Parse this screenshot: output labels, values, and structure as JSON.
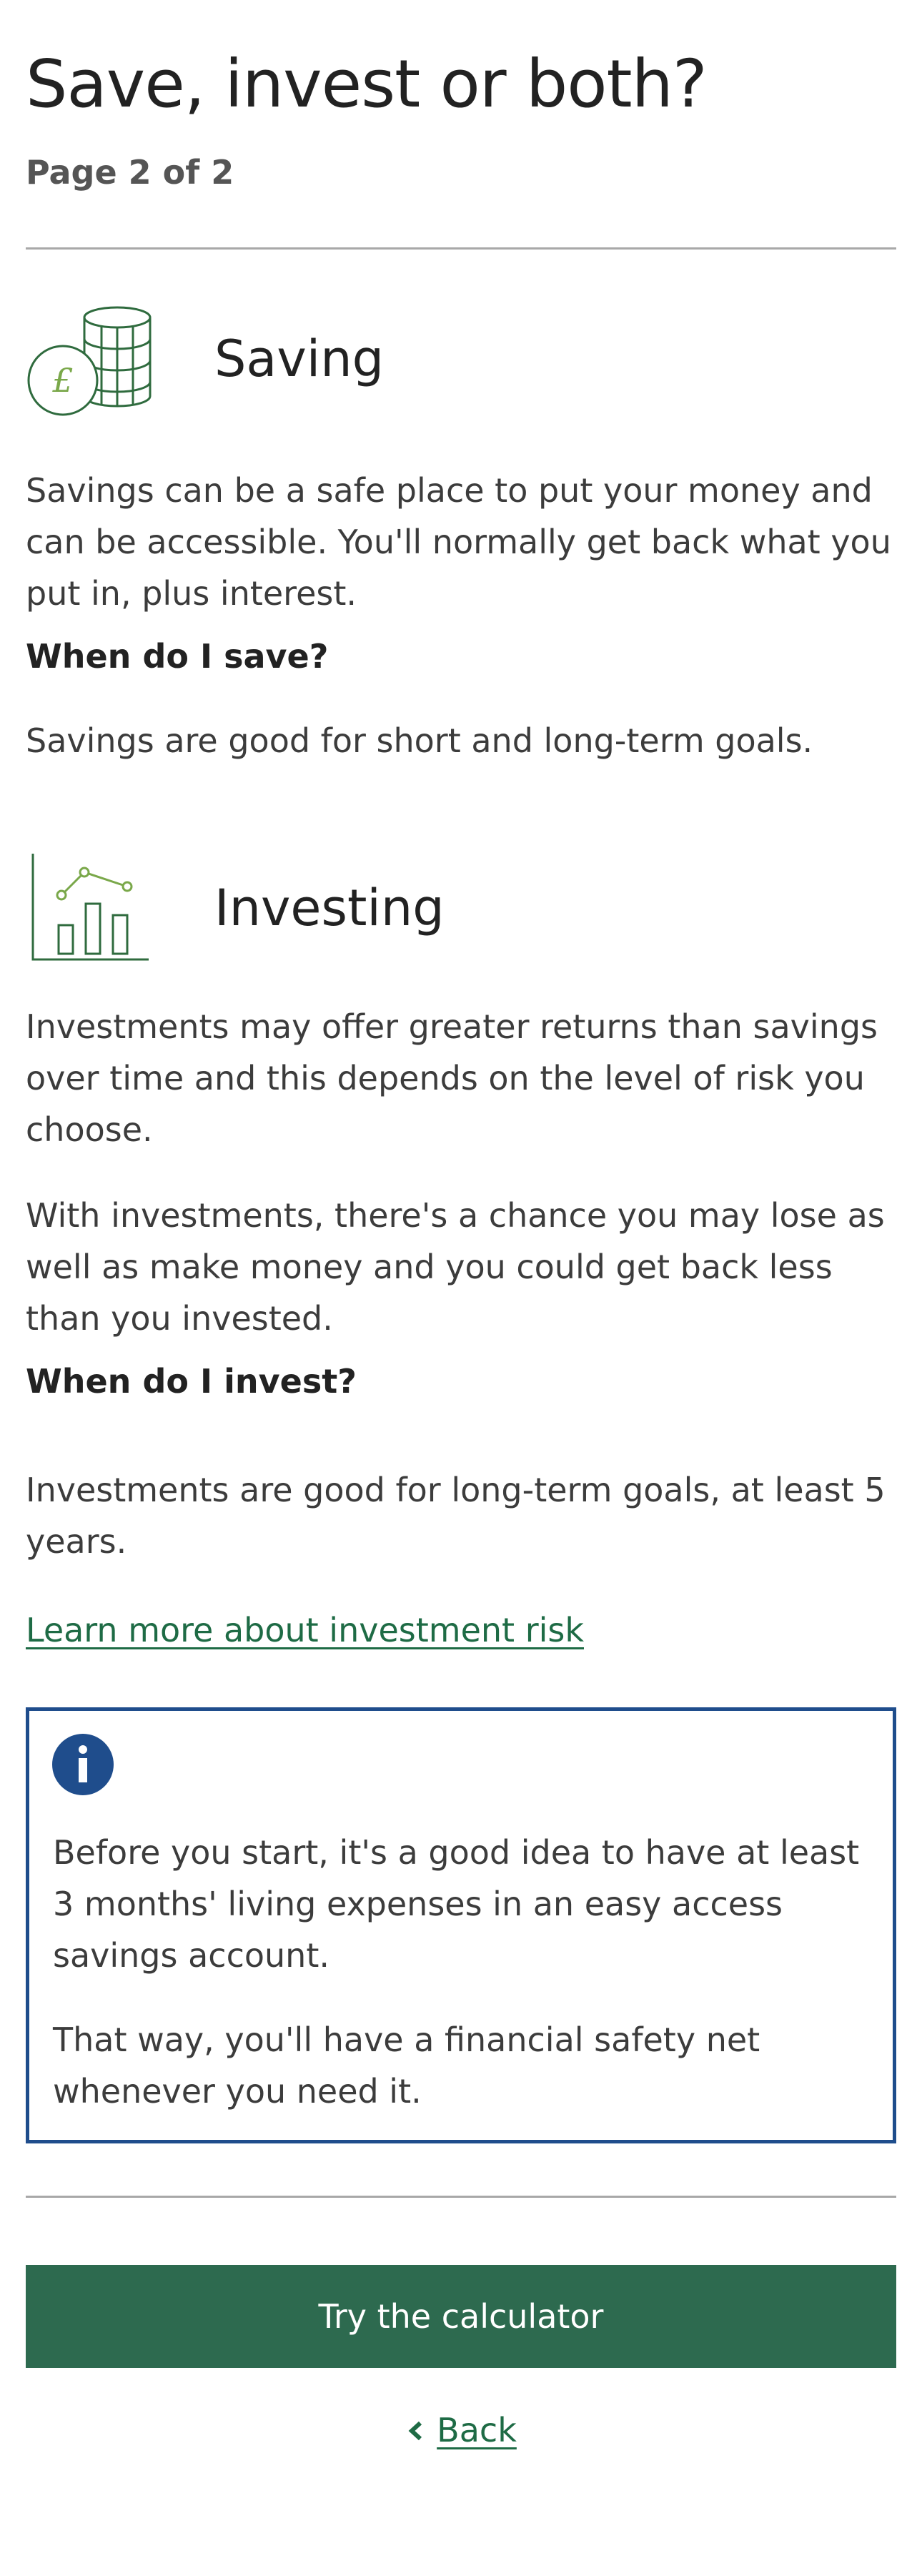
{
  "header": {
    "title": "Save, invest or both?",
    "page_count": "Page 2 of 2"
  },
  "saving": {
    "icon": "coins-icon",
    "title": "Saving",
    "description": "Savings can be a safe place to put your money and can be accessible. You'll normally get back what you put in, plus interest.",
    "question": "When do I save?",
    "answer": "Savings are good for short and long-term goals."
  },
  "investing": {
    "icon": "chart-icon",
    "title": "Investing",
    "description_1": "Investments may offer greater returns than savings over time and this depends on the level of risk you choose.",
    "description_2": "With investments, there's a chance you may lose as well as make money and you could get back less than you invested.",
    "question": "When do I invest?",
    "answer": "Investments are good for long-term goals, at least 5 years.",
    "link": "Learn more about investment risk"
  },
  "info_box": {
    "icon": "info-icon",
    "text_1": "Before you start, it's a good idea to have at least 3 months' living expenses in an easy access savings account.",
    "text_2": "That way, you'll have a financial safety net whenever you need it."
  },
  "actions": {
    "primary_label": "Try the calculator",
    "back_label": "Back"
  },
  "colors": {
    "primary_green": "#2d6a4f",
    "link_green": "#1e6b45",
    "info_blue": "#1f4d8c",
    "icon_green": "#2f6b3e"
  }
}
